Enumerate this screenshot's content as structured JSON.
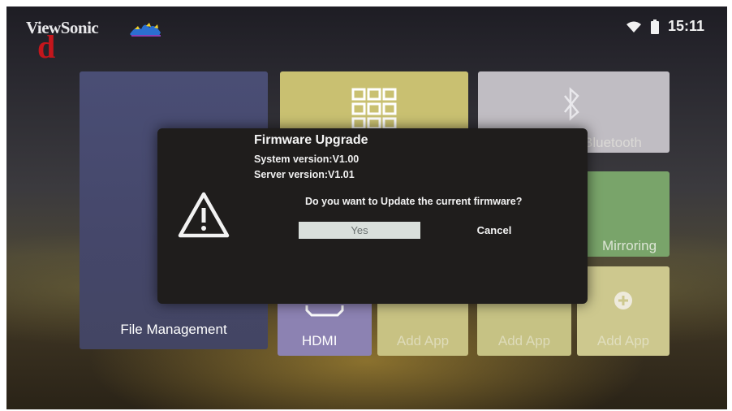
{
  "brand": {
    "name": "ViewSonic",
    "overlay_letter": "d"
  },
  "status_bar": {
    "time": "15:11",
    "wifi_icon": "wifi-icon",
    "battery_icon": "battery-icon"
  },
  "tiles": {
    "file_management": "File Management",
    "bluetooth": "Bluetooth",
    "mirroring": "Mirroring",
    "hdmi": "HDMI",
    "add_app_1": "Add App",
    "add_app_2": "Add App",
    "add_app_3": "Add App"
  },
  "dialog": {
    "title": "Firmware Upgrade",
    "system_version": "System version:V1.00",
    "server_version": "Server version:V1.01",
    "question": "Do you want to Update the current firmware?",
    "yes_label": "Yes",
    "cancel_label": "Cancel",
    "icon": "warning-icon"
  },
  "colors": {
    "yes_focus": "#d9dfdb",
    "brand_mark": "#c4161c",
    "dialog_bg": "#1f1d1c"
  }
}
